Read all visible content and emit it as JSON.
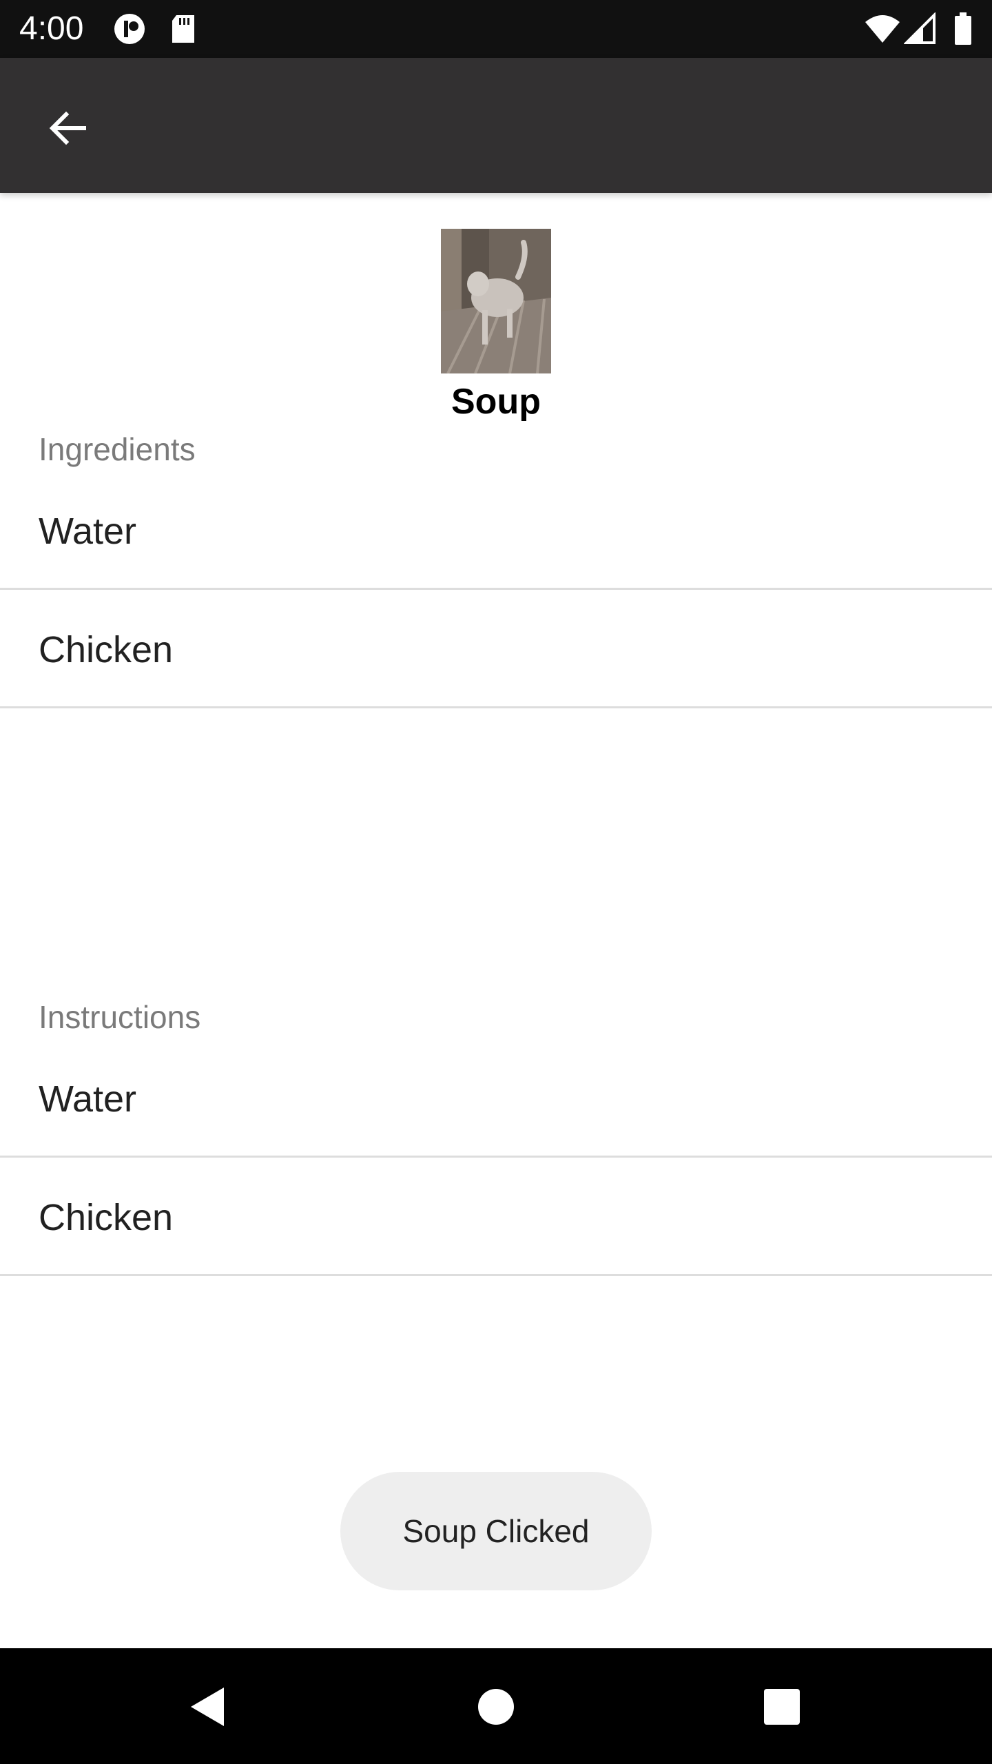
{
  "status_bar": {
    "time": "4:00",
    "icons": [
      "app-notification-icon",
      "sd-card-icon",
      "wifi-icon",
      "cell-signal-icon",
      "battery-icon"
    ]
  },
  "app_bar": {
    "back_icon": "arrow-left-icon",
    "background_color": "#323031"
  },
  "recipe": {
    "title": "Soup",
    "image": "recipe-photo"
  },
  "ingredients": {
    "label": "Ingredients",
    "items": [
      "Water",
      "Chicken"
    ]
  },
  "instructions": {
    "label": "Instructions",
    "items": [
      "Water",
      "Chicken"
    ]
  },
  "toast": {
    "message": "Soup Clicked"
  },
  "nav_bar": {
    "buttons": [
      "back-triangle-icon",
      "home-circle-icon",
      "recents-square-icon"
    ]
  }
}
